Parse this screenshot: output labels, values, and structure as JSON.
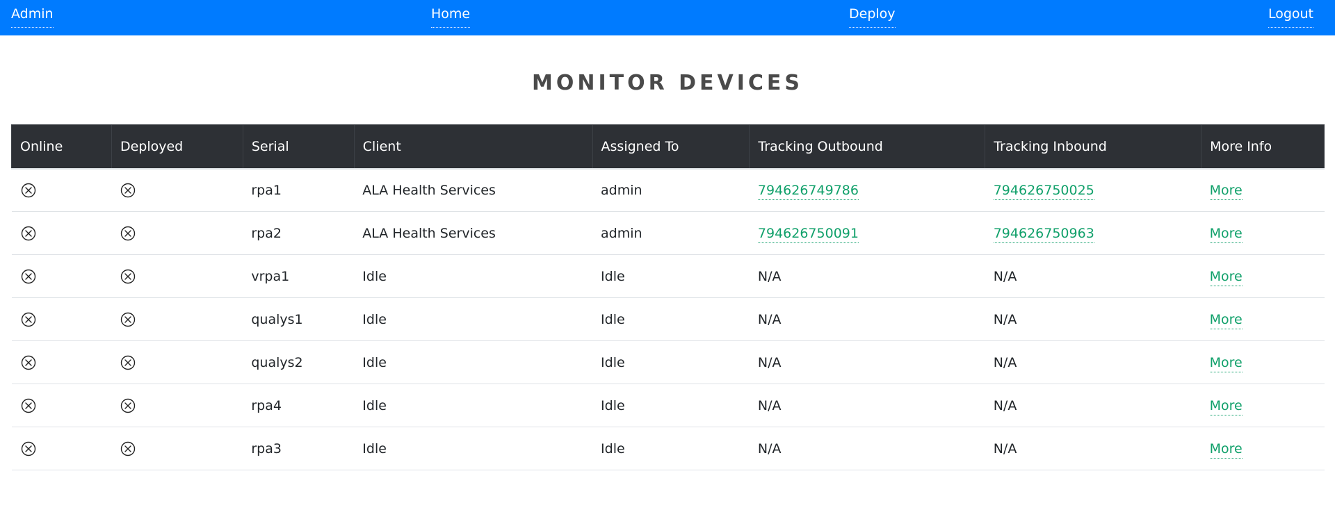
{
  "nav": {
    "admin": "Admin",
    "home": "Home",
    "deploy": "Deploy",
    "logout": "Logout"
  },
  "page": {
    "title": "MONITOR DEVICES"
  },
  "table": {
    "headers": [
      "Online",
      "Deployed",
      "Serial",
      "Client",
      "Assigned To",
      "Tracking Outbound",
      "Tracking Inbound",
      "More Info"
    ],
    "rows": [
      {
        "online": "offline",
        "deployed": "not-deployed",
        "serial": "rpa1",
        "client": "ALA Health Services",
        "assigned_to": "admin",
        "tracking_outbound": "794626749786",
        "tracking_inbound": "794626750025",
        "more": "More"
      },
      {
        "online": "offline",
        "deployed": "not-deployed",
        "serial": "rpa2",
        "client": "ALA Health Services",
        "assigned_to": "admin",
        "tracking_outbound": "794626750091",
        "tracking_inbound": "794626750963",
        "more": "More"
      },
      {
        "online": "offline",
        "deployed": "not-deployed",
        "serial": "vrpa1",
        "client": "Idle",
        "assigned_to": "Idle",
        "tracking_outbound": "N/A",
        "tracking_inbound": "N/A",
        "more": "More"
      },
      {
        "online": "offline",
        "deployed": "not-deployed",
        "serial": "qualys1",
        "client": "Idle",
        "assigned_to": "Idle",
        "tracking_outbound": "N/A",
        "tracking_inbound": "N/A",
        "more": "More"
      },
      {
        "online": "offline",
        "deployed": "not-deployed",
        "serial": "qualys2",
        "client": "Idle",
        "assigned_to": "Idle",
        "tracking_outbound": "N/A",
        "tracking_inbound": "N/A",
        "more": "More"
      },
      {
        "online": "offline",
        "deployed": "not-deployed",
        "serial": "rpa4",
        "client": "Idle",
        "assigned_to": "Idle",
        "tracking_outbound": "N/A",
        "tracking_inbound": "N/A",
        "more": "More"
      },
      {
        "online": "offline",
        "deployed": "not-deployed",
        "serial": "rpa3",
        "client": "Idle",
        "assigned_to": "Idle",
        "tracking_outbound": "N/A",
        "tracking_inbound": "N/A",
        "more": "More"
      }
    ]
  },
  "icons": {
    "status": "circle-x-icon"
  },
  "colors": {
    "navbar": "#007bff",
    "table_header": "#2d3035",
    "link": "#10a06a"
  }
}
